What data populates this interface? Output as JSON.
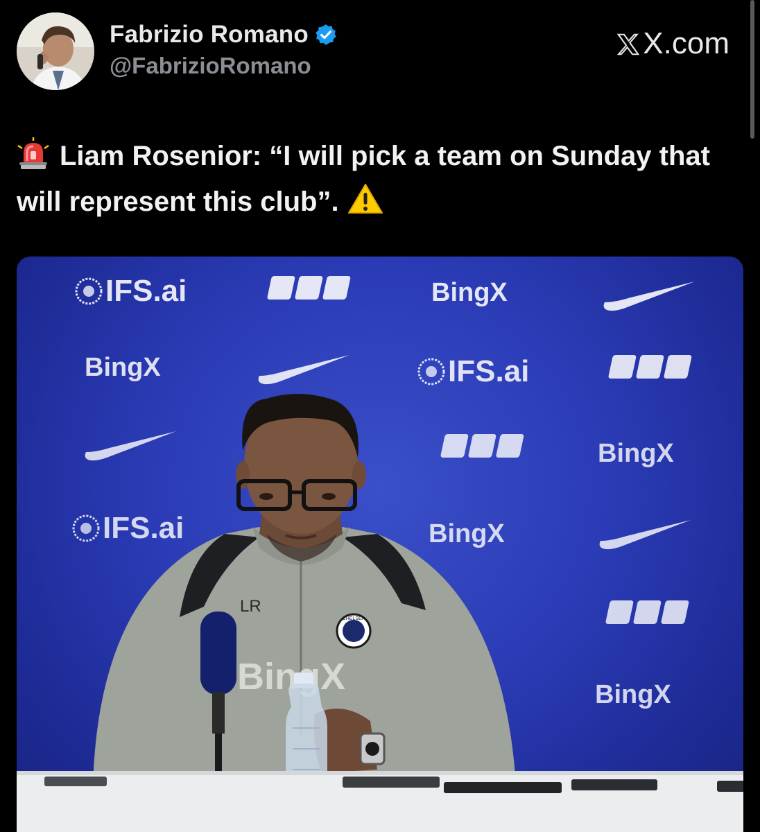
{
  "source_site": "X.com",
  "post": {
    "author": {
      "display_name": "Fabrizio Romano",
      "handle": "@FabrizioRomano",
      "verified": true
    },
    "text": "Liam Rosenior: “I will pick a team on Sunday that will represent this club”.",
    "leading_emoji": "rotating-light-icon",
    "trailing_emoji": "warning-icon"
  },
  "photo": {
    "backdrop_logos": {
      "ifs": "IFS.ai",
      "fpt": "FPT",
      "bingx": "BingX"
    },
    "jacket_initials": "LR",
    "jacket_sponsor": "BingX",
    "crest_text": "CHELSEA"
  },
  "colors": {
    "background": "#000000",
    "text_primary": "#e7e9ea",
    "text_secondary": "#8b8f94",
    "verified_badge": "#1d9bf0",
    "backdrop_blue": "#2a3bb5"
  }
}
